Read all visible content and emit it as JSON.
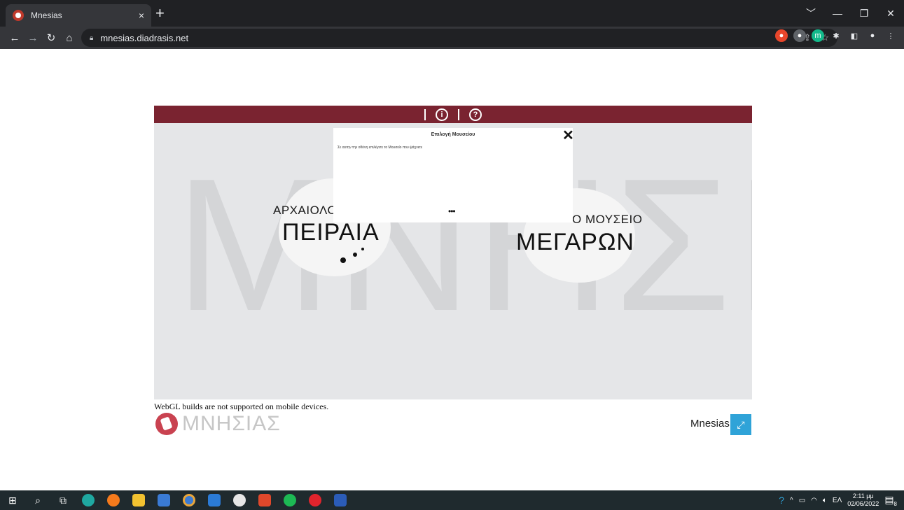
{
  "browser": {
    "tab_title": "Mnesias",
    "tab_close": "×",
    "new_tab": "+",
    "url": "mnesias.diadrasis.net",
    "window_controls": {
      "dropdown": "﹀",
      "minimize": "—",
      "restore": "❐",
      "close": "✕"
    }
  },
  "app": {
    "topbar": {
      "info_label": "i",
      "help_label": "?"
    },
    "background_word": "ΜΝΗΣΙΑΣ",
    "museum_left": {
      "line1": "ΑΡΧΑΙΟΛΟΓ",
      "line2": "ΠΕΙΡΑΙΑ"
    },
    "museum_right": {
      "line1": "Ο ΜΟΥΣΕΙΟ",
      "line2": "ΜΕΓΑΡΩΝ"
    },
    "dialog": {
      "title": "Επιλογή Μουσείου",
      "text": "Σε αυτην την οθόνη επιλέγετε το Μουσείο που ψάχνετε",
      "close": "✕",
      "dots": "•••"
    }
  },
  "page": {
    "webgl_note": "WebGL builds are not supported on mobile devices.",
    "logo_word": "ΜΝΗΣΙΑΣ",
    "footer_title": "Mnesias",
    "fullscreen_icon": "⤢"
  },
  "taskbar": {
    "lang": "ΕΛ",
    "time": "2:11 μμ",
    "date": "02/06/2022",
    "notifications": "8"
  },
  "colors": {
    "brand": "#7a2330",
    "accent": "#2fa3d8",
    "logo": "#c94250"
  }
}
